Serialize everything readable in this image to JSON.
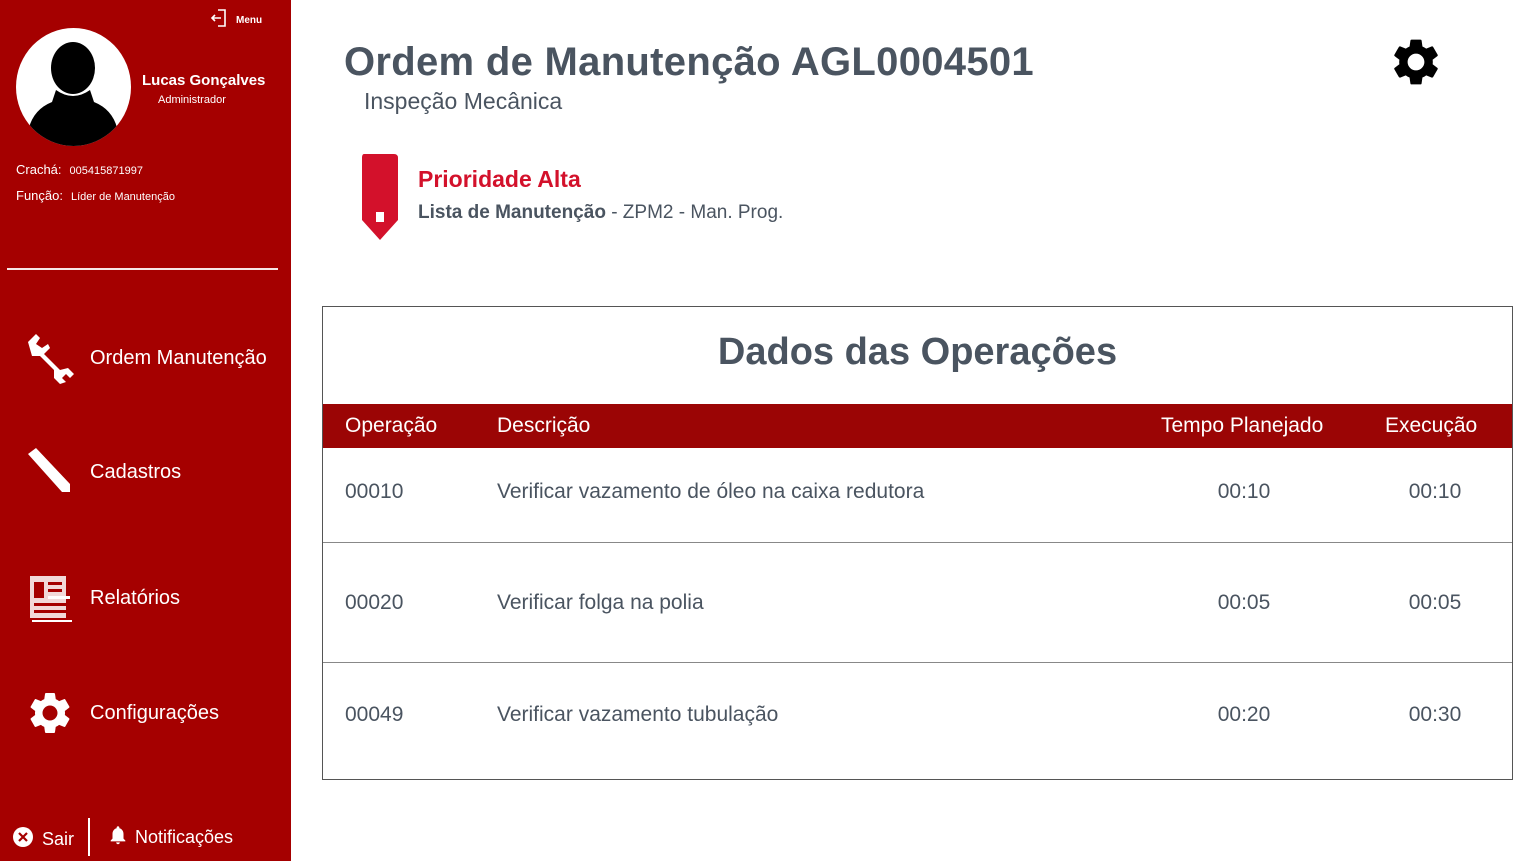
{
  "sidebar": {
    "menu_label": "Menu",
    "user": {
      "name": "Lucas Gonçalves",
      "role": "Administrador",
      "badge_label": "Crachá:",
      "badge_value": "005415871997",
      "function_label": "Função:",
      "function_value": "Líder de Manutenção"
    },
    "nav": [
      {
        "label": "Ordem Manutenção",
        "icon": "wrench-icon"
      },
      {
        "label": "Cadastros",
        "icon": "pencil-icon"
      },
      {
        "label": "Relatórios",
        "icon": "report-icon"
      },
      {
        "label": "Configurações",
        "icon": "gear-icon"
      }
    ],
    "logout_label": "Sair",
    "notifications_label": "Notificações"
  },
  "header": {
    "title": "Ordem de Manutenção AGL0004501",
    "subtitle": "Inspeção Mecânica"
  },
  "priority": {
    "label": "Prioridade Alta",
    "list_label": "Lista de Manutenção",
    "list_value": " - ZPM2 - Man. Prog."
  },
  "operations": {
    "title": "Dados das Operações",
    "columns": [
      "Operação",
      "Descrição",
      "Tempo Planejado",
      "Execução"
    ],
    "rows": [
      {
        "op": "00010",
        "desc": "Verificar vazamento de óleo na caixa redutora",
        "planned": "00:10",
        "exec": "00:10"
      },
      {
        "op": "00020",
        "desc": "Verificar folga na polia",
        "planned": "00:05",
        "exec": "00:05"
      },
      {
        "op": "00049",
        "desc": "Verificar vazamento tubulação",
        "planned": "00:20",
        "exec": "00:30"
      }
    ]
  },
  "colors": {
    "sidebar_bg": "#a50000",
    "table_header_bg": "#9b0505",
    "priority_red": "#d3112b",
    "text": "#4a5460"
  }
}
